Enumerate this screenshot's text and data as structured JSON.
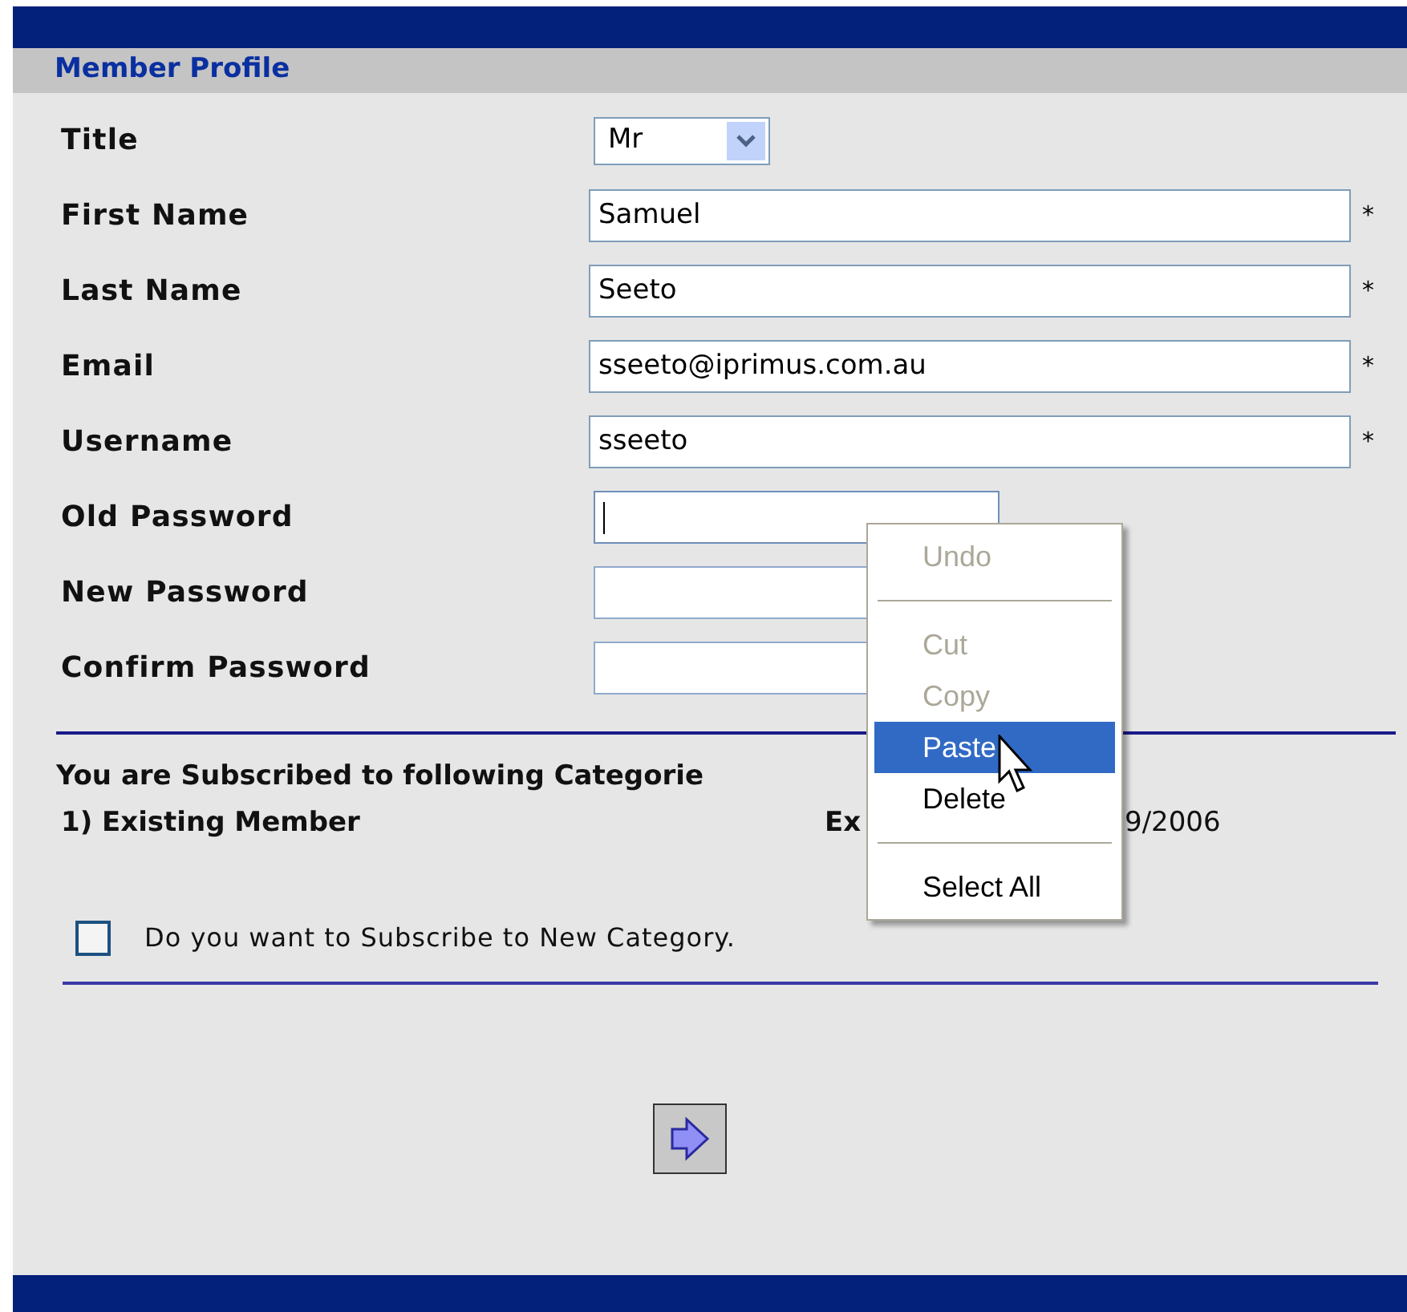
{
  "header": {
    "title": "Member Profile"
  },
  "fields": [
    {
      "kind": "select",
      "label": "Title",
      "value": "Mr"
    },
    {
      "kind": "text",
      "label": "First Name",
      "value": "Samuel",
      "required_mark": "*"
    },
    {
      "kind": "text",
      "label": "Last Name",
      "value": "Seeto",
      "required_mark": "*"
    },
    {
      "kind": "text",
      "label": "Email",
      "value": "sseeto@iprimus.com.au",
      "required_mark": "*"
    },
    {
      "kind": "text",
      "label": "Username",
      "value": "sseeto",
      "required_mark": "*"
    },
    {
      "kind": "password",
      "label": "Old Password",
      "focused": true
    },
    {
      "kind": "password",
      "label": "New Password",
      "focused": false
    },
    {
      "kind": "password",
      "label": "Confirm Password",
      "focused": false
    }
  ],
  "subscriptions": {
    "heading": "You are Subscribed to following Categorie",
    "rows": [
      {
        "name": "1) Existing Member",
        "column_2": "Ex",
        "column_3": "9/2006"
      }
    ]
  },
  "subscribe_new": {
    "label": "Do you want to Subscribe to New Category.",
    "checked": false
  },
  "context_menu": [
    {
      "kind": "item",
      "label": "Undo",
      "disabled": true,
      "selected": false
    },
    {
      "kind": "separator"
    },
    {
      "kind": "item",
      "label": "Cut",
      "disabled": true,
      "selected": false
    },
    {
      "kind": "item",
      "label": "Copy",
      "disabled": true,
      "selected": false
    },
    {
      "kind": "item",
      "label": "Paste",
      "disabled": false,
      "selected": true
    },
    {
      "kind": "item",
      "label": "Delete",
      "disabled": false,
      "selected": false
    },
    {
      "kind": "separator"
    },
    {
      "kind": "item",
      "label": "Select All",
      "disabled": false,
      "selected": false
    }
  ]
}
